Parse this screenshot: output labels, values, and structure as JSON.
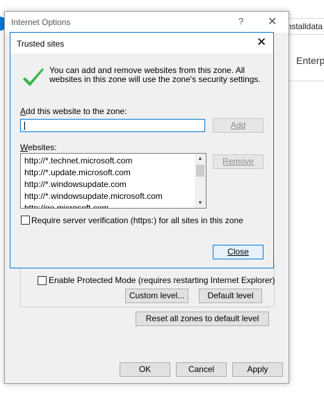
{
  "background": {
    "top_right_text": "installdata",
    "side_text": "Enterp"
  },
  "internet_options": {
    "title": "Internet Options",
    "help_glyph": "?",
    "close_glyph": "✕",
    "protected_mode_label": "Enable Protected Mode (requires restarting Internet Explorer)",
    "custom_level_label": "Custom level...",
    "default_level_label": "Default level",
    "reset_all_label": "Reset all zones to default level",
    "ok_label": "OK",
    "cancel_label": "Cancel",
    "apply_label": "Apply"
  },
  "trusted_sites": {
    "title": "Trusted sites",
    "close_glyph": "✕",
    "info_text": "You can add and remove websites from this zone. All websites in this zone will use the zone's security settings.",
    "add_label": "Add this website to the zone:",
    "add_input_value": "",
    "add_button_label": "Add",
    "websites_label": "Websites:",
    "websites": [
      "http://*.technet.microsoft.com",
      "http://*.update.microsoft.com",
      "http://*.windowsupdate.com",
      "http://*.windowsupdate.microsoft.com",
      "http://go.microsoft.com"
    ],
    "remove_button_label": "Remove",
    "require_verification_label": "Require server verification (https:) for all sites in this zone",
    "require_verification_checked": false,
    "close_button_label": "Close"
  },
  "colors": {
    "accent": "#0078d7",
    "checkmark": "#3bb54a",
    "dialog_bg": "#f0f0f0"
  }
}
